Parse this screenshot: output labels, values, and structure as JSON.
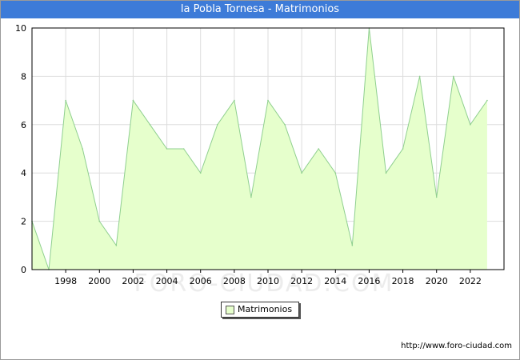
{
  "title": "la Pobla Tornesa - Matrimonios",
  "source_url": "http://www.foro-ciudad.com",
  "watermark": "FORO-CIUDAD.COM",
  "colors": {
    "title_bg": "#3d7bd8",
    "area_fill": "#e6ffcc",
    "line": "#8fcf8f",
    "grid": "#dddddd"
  },
  "chart_data": {
    "type": "area",
    "title": "la Pobla Tornesa - Matrimonios",
    "xlabel": "",
    "ylabel": "",
    "x": [
      1996,
      1997,
      1998,
      1999,
      2000,
      2001,
      2002,
      2003,
      2004,
      2005,
      2006,
      2007,
      2008,
      2009,
      2010,
      2011,
      2012,
      2013,
      2014,
      2015,
      2016,
      2017,
      2018,
      2019,
      2020,
      2021,
      2022,
      2023
    ],
    "series": [
      {
        "name": "Matrimonios",
        "values": [
          2,
          0,
          7,
          5,
          2,
          1,
          7,
          6,
          5,
          5,
          4,
          6,
          7,
          3,
          7,
          6,
          4,
          5,
          4,
          1,
          10,
          4,
          5,
          8,
          3,
          8,
          6,
          7
        ]
      }
    ],
    "xlim": [
      1996,
      2024
    ],
    "ylim": [
      0,
      10
    ],
    "x_ticks": [
      "1998",
      "2000",
      "2002",
      "2004",
      "2006",
      "2008",
      "2010",
      "2012",
      "2014",
      "2016",
      "2018",
      "2020",
      "2022"
    ],
    "y_ticks": [
      "0",
      "2",
      "4",
      "6",
      "8",
      "10"
    ],
    "grid": true,
    "legend_position": "bottom-center"
  }
}
